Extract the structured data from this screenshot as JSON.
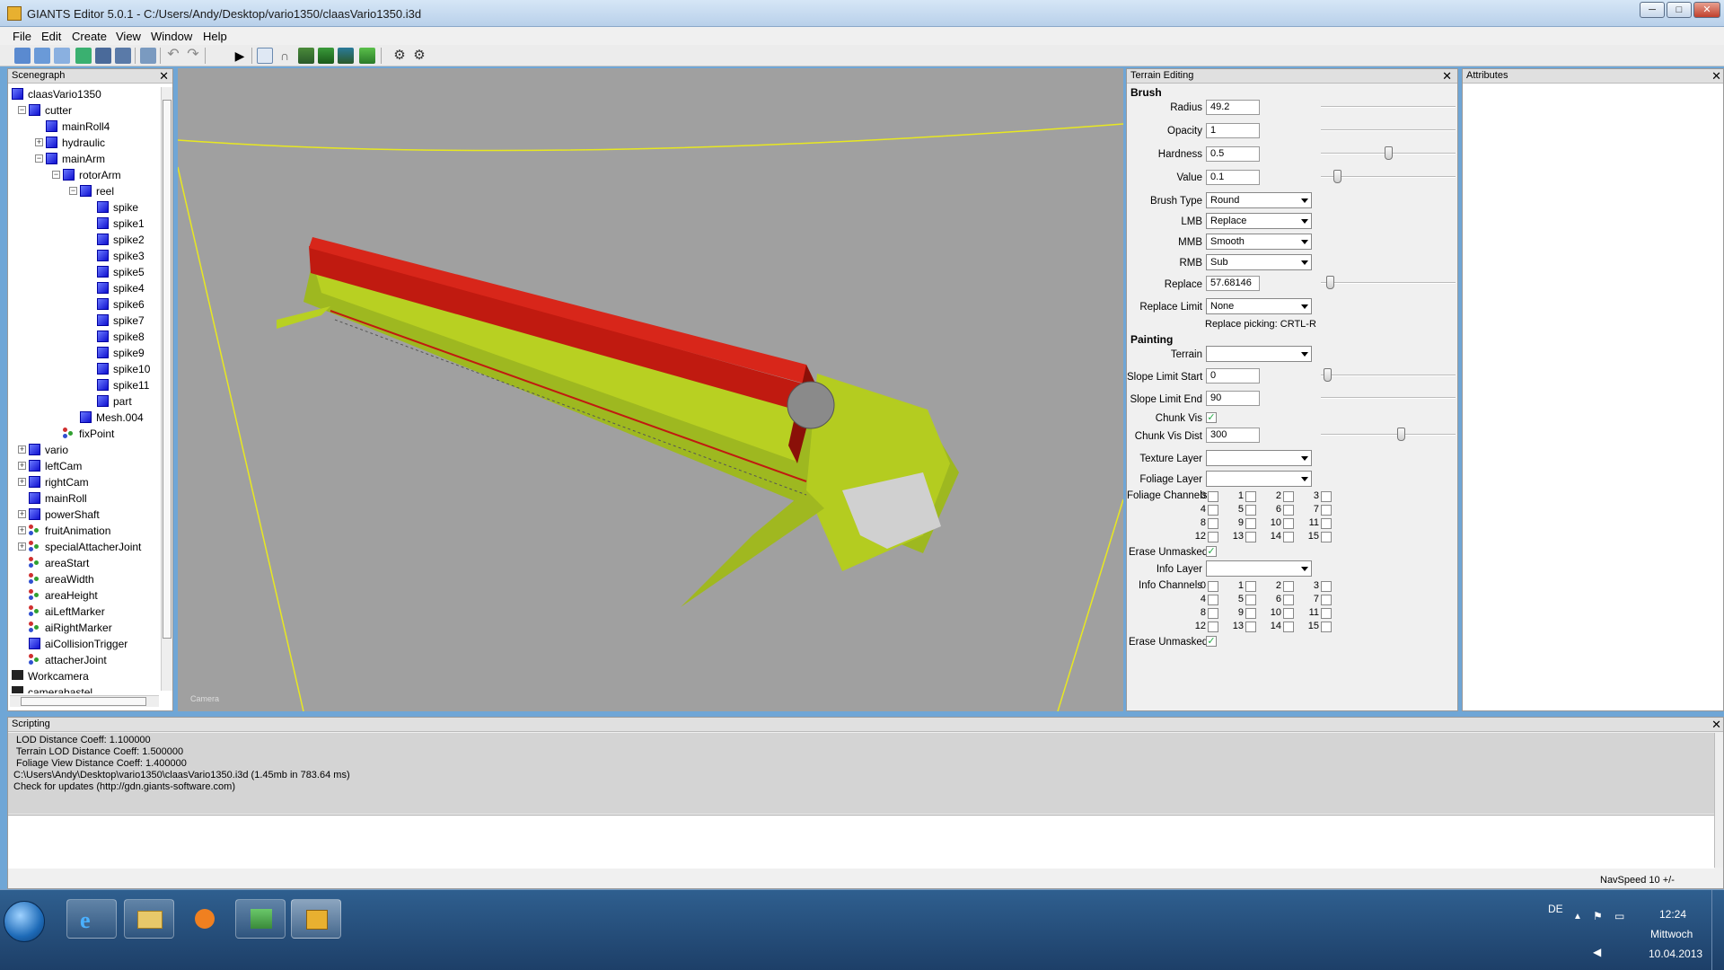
{
  "window": {
    "title": "GIANTS Editor 5.0.1 - C:/Users/Andy/Desktop/vario1350/claasVario1350.i3d",
    "controls": [
      "─",
      "□",
      "✕"
    ]
  },
  "menu": [
    "File",
    "Edit",
    "Create",
    "View",
    "Window",
    "Help"
  ],
  "toolbar_icons": [
    "new-icon",
    "open-icon",
    "recent-icon",
    "reload-icon",
    "save-icon",
    "save-as-icon",
    "import-icon",
    "undo-icon",
    "redo-icon",
    "play-icon",
    "select-icon",
    "move-icon",
    "terrain-sculpt-icon",
    "terrain-paint-icon",
    "terrain-foliage-icon",
    "foliage-paint-icon",
    "settings-icon",
    "tools-icon"
  ],
  "scenegraph": {
    "title": "Scenegraph",
    "nodes": [
      {
        "label": "claasVario1350",
        "depth": 0,
        "icon": "cube",
        "toggle": ""
      },
      {
        "label": "cutter",
        "depth": 1,
        "icon": "cube",
        "toggle": "−"
      },
      {
        "label": "mainRoll4",
        "depth": 2,
        "icon": "cube",
        "toggle": ""
      },
      {
        "label": "hydraulic",
        "depth": 2,
        "icon": "cube",
        "toggle": "+"
      },
      {
        "label": "mainArm",
        "depth": 2,
        "icon": "cube",
        "toggle": "−"
      },
      {
        "label": "rotorArm",
        "depth": 3,
        "icon": "cube",
        "toggle": "−"
      },
      {
        "label": "reel",
        "depth": 4,
        "icon": "cube",
        "toggle": "−"
      },
      {
        "label": "spike",
        "depth": 5,
        "icon": "cube",
        "toggle": ""
      },
      {
        "label": "spike1",
        "depth": 5,
        "icon": "cube",
        "toggle": ""
      },
      {
        "label": "spike2",
        "depth": 5,
        "icon": "cube",
        "toggle": ""
      },
      {
        "label": "spike3",
        "depth": 5,
        "icon": "cube",
        "toggle": ""
      },
      {
        "label": "spike5",
        "depth": 5,
        "icon": "cube",
        "toggle": ""
      },
      {
        "label": "spike4",
        "depth": 5,
        "icon": "cube",
        "toggle": ""
      },
      {
        "label": "spike6",
        "depth": 5,
        "icon": "cube",
        "toggle": ""
      },
      {
        "label": "spike7",
        "depth": 5,
        "icon": "cube",
        "toggle": ""
      },
      {
        "label": "spike8",
        "depth": 5,
        "icon": "cube",
        "toggle": ""
      },
      {
        "label": "spike9",
        "depth": 5,
        "icon": "cube",
        "toggle": ""
      },
      {
        "label": "spike10",
        "depth": 5,
        "icon": "cube",
        "toggle": ""
      },
      {
        "label": "spike11",
        "depth": 5,
        "icon": "cube",
        "toggle": ""
      },
      {
        "label": "part",
        "depth": 5,
        "icon": "cube",
        "toggle": ""
      },
      {
        "label": "Mesh.004",
        "depth": 4,
        "icon": "cube",
        "toggle": ""
      },
      {
        "label": "fixPoint",
        "depth": 3,
        "icon": "transform",
        "toggle": ""
      },
      {
        "label": "vario",
        "depth": 1,
        "icon": "cube",
        "toggle": "+"
      },
      {
        "label": "leftCam",
        "depth": 1,
        "icon": "cube",
        "toggle": "+"
      },
      {
        "label": "rightCam",
        "depth": 1,
        "icon": "cube",
        "toggle": "+"
      },
      {
        "label": "mainRoll",
        "depth": 1,
        "icon": "cube",
        "toggle": ""
      },
      {
        "label": "powerShaft",
        "depth": 1,
        "icon": "cube",
        "toggle": "+"
      },
      {
        "label": "fruitAnimation",
        "depth": 1,
        "icon": "transform",
        "toggle": "+"
      },
      {
        "label": "specialAttacherJoint",
        "depth": 1,
        "icon": "transform",
        "toggle": "+"
      },
      {
        "label": "areaStart",
        "depth": 1,
        "icon": "transform",
        "toggle": ""
      },
      {
        "label": "areaWidth",
        "depth": 1,
        "icon": "transform",
        "toggle": ""
      },
      {
        "label": "areaHeight",
        "depth": 1,
        "icon": "transform",
        "toggle": ""
      },
      {
        "label": "aiLeftMarker",
        "depth": 1,
        "icon": "transform",
        "toggle": ""
      },
      {
        "label": "aiRightMarker",
        "depth": 1,
        "icon": "transform",
        "toggle": ""
      },
      {
        "label": "aiCollisionTrigger",
        "depth": 1,
        "icon": "cube",
        "toggle": ""
      },
      {
        "label": "attacherJoint",
        "depth": 1,
        "icon": "transform",
        "toggle": ""
      },
      {
        "label": "Workcamera",
        "depth": 0,
        "icon": "camera",
        "toggle": ""
      },
      {
        "label": "camerabastel",
        "depth": 0,
        "icon": "camera",
        "toggle": ""
      }
    ]
  },
  "viewport": {
    "camera_label": "Camera"
  },
  "terrain": {
    "title": "Terrain Editing",
    "brush_header": "Brush",
    "painting_header": "Painting",
    "radius": {
      "label": "Radius",
      "value": "49.2",
      "slider": 0
    },
    "opacity": {
      "label": "Opacity",
      "value": "1",
      "slider": 0
    },
    "hardness": {
      "label": "Hardness",
      "value": "0.5",
      "slider": 0.5
    },
    "value": {
      "label": "Value",
      "value": "0.1",
      "slider": 0.1
    },
    "brush_type": {
      "label": "Brush Type",
      "value": "Round"
    },
    "lmb": {
      "label": "LMB",
      "value": "Replace"
    },
    "mmb": {
      "label": "MMB",
      "value": "Smooth"
    },
    "rmb": {
      "label": "RMB",
      "value": "Sub"
    },
    "replace": {
      "label": "Replace",
      "value": "57.68146",
      "slider": 0.04
    },
    "replace_limit": {
      "label": "Replace Limit",
      "value": "None"
    },
    "replace_picking": "Replace picking: CRTL-R",
    "terrain_sel": {
      "label": "Terrain",
      "value": ""
    },
    "slope_start": {
      "label": "Slope Limit Start",
      "value": "0",
      "slider": 0.02
    },
    "slope_end": {
      "label": "Slope Limit End",
      "value": "90"
    },
    "chunk_vis": {
      "label": "Chunk Vis",
      "checked": true
    },
    "chunk_vis_dist": {
      "label": "Chunk Vis Dist",
      "value": "300",
      "slider": 0.6
    },
    "texture_layer": {
      "label": "Texture Layer",
      "value": ""
    },
    "foliage_layer": {
      "label": "Foliage Layer",
      "value": ""
    },
    "foliage_channels_label": "Foliage Channels",
    "erase_unmasked_label": "Erase Unmasked",
    "info_layer": {
      "label": "Info Layer",
      "value": ""
    },
    "info_channels_label": "Info Channels",
    "channels": [
      "0",
      "1",
      "2",
      "3",
      "4",
      "5",
      "6",
      "7",
      "8",
      "9",
      "10",
      "11",
      "12",
      "13",
      "14",
      "15"
    ]
  },
  "attributes": {
    "title": "Attributes"
  },
  "scripting": {
    "title": "Scripting",
    "output": " LOD Distance Coeff: 1.100000\n Terrain LOD Distance Coeff: 1.500000\n Foliage View Distance Coeff: 1.400000\nC:\\Users\\Andy\\Desktop\\vario1350\\claasVario1350.i3d (1.45mb in 783.64 ms)\nCheck for updates (http://gdn.giants-software.com)",
    "navspeed": "NavSpeed 10 +/-"
  },
  "taskbar": {
    "lang": "DE",
    "time": "12:24",
    "day": "Mittwoch",
    "date": "10.04.2013",
    "apps": [
      "internet-explorer-icon",
      "file-explorer-icon",
      "media-player-icon",
      "control-panel-icon",
      "giants-editor-icon"
    ]
  },
  "colors": {
    "title_bg": "#c6dcf2",
    "viewport_bg": "#a0a0a0",
    "cutter_red": "#c01a10",
    "cutter_green": "#b4d020",
    "taskbar": "#244c7c"
  }
}
